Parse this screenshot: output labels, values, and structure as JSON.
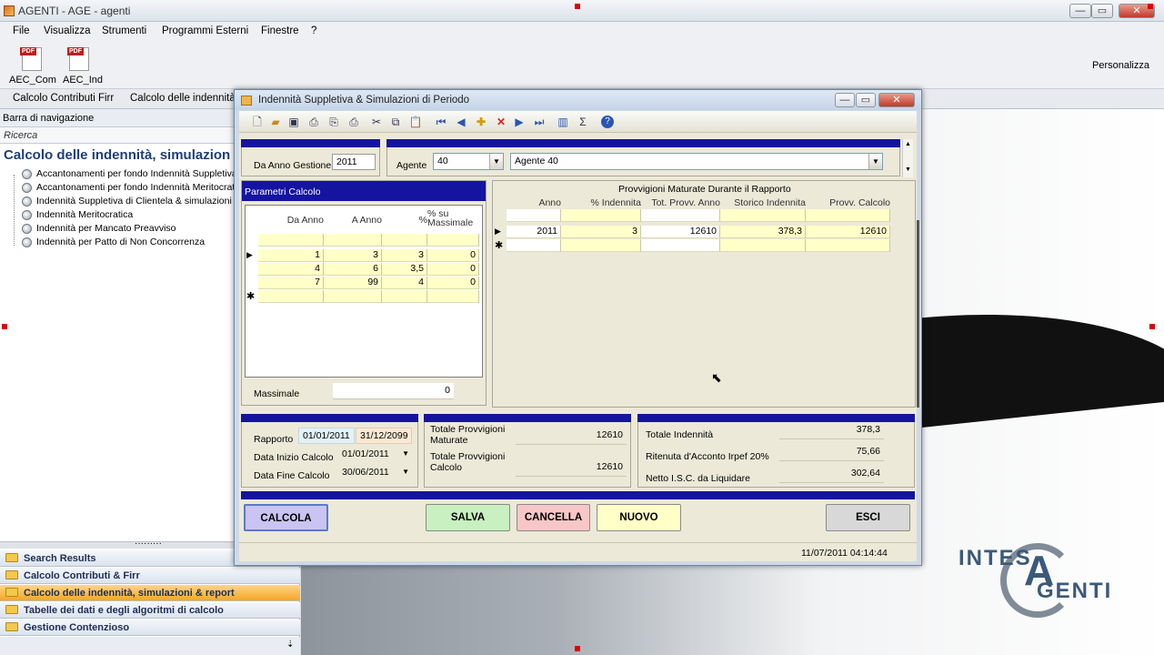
{
  "window": {
    "title": "AGENTI - AGE - agenti",
    "min": "—",
    "max": "▭",
    "close": "✕"
  },
  "menu": [
    "File",
    "Visualizza",
    "Strumenti",
    "Programmi Esterni",
    "Finestre",
    "?"
  ],
  "toolbar": {
    "btn1": "AEC_Com",
    "btn2": "AEC_Ind",
    "personalizza": "Personalizza"
  },
  "tabs": [
    "Calcolo Contributi  Firr",
    "Calcolo delle indennità"
  ],
  "nav": {
    "header": "Barra di navigazione",
    "search": "Ricerca",
    "title": "Calcolo delle indennità, simulazion",
    "items": [
      "Accantonamenti per fondo Indennità Suppletiva d",
      "Accantonamenti per fondo Indennità Meritocratic",
      "Indennità Suppletiva di Clientela & simulazioni di p",
      "Indennità Meritocratica",
      "Indennità per Mancato Preavviso",
      "Indennità per Patto di Non Concorrenza"
    ],
    "splitter": "·········",
    "groups": [
      "Search Results",
      "Calcolo Contributi & Firr",
      "Calcolo delle indennità, simulazioni & report",
      "Tabelle dei dati e degli algoritmi di calcolo",
      "Gestione Contenzioso"
    ],
    "more": "⇣"
  },
  "logo": {
    "line1": "INTES",
    "a": "A",
    "line2": "GENTI"
  },
  "dialog": {
    "title": "Indennità Suppletiva & Simulazioni di Periodo",
    "da_anno_label": "Da Anno Gestione",
    "da_anno_value": "2011",
    "agente_label": "Agente",
    "agente_code": "40",
    "agente_name": "Agente 40",
    "param_title": "Parametri Calcolo",
    "param_headers": [
      "Da Anno",
      "A Anno",
      "%",
      "% su Massimale"
    ],
    "param_rows": [
      [
        "1",
        "3",
        "3",
        "0"
      ],
      [
        "4",
        "6",
        "3,5",
        "0"
      ],
      [
        "7",
        "99",
        "4",
        "0"
      ]
    ],
    "massimale_label": "Massimale",
    "massimale_value": "0",
    "provv_title": "Provvigioni Maturate Durante il Rapporto",
    "provv_headers": [
      "Anno",
      "% Indennita",
      "Tot. Provv. Anno",
      "Storico Indennita",
      "Provv. Calcolo"
    ],
    "provv_rows": [
      [
        "2011",
        "3",
        "12610",
        "378,3",
        "12610"
      ]
    ],
    "rapporto_label": "Rapporto",
    "rapporto_from": "01/01/2011",
    "rapporto_to": "31/12/2099",
    "inizio_label": "Data Inizio Calcolo",
    "inizio_value": "01/01/2011",
    "fine_label": "Data Fine Calcolo",
    "fine_value": "30/06/2011",
    "tot_provv_mat_label": "Totale Provvigioni Maturate",
    "tot_provv_mat_value": "12610",
    "tot_provv_calc_label": "Totale Provvigioni Calcolo",
    "tot_provv_calc_value": "12610",
    "tot_ind_label": "Totale Indennità",
    "tot_ind_value": "378,3",
    "ritenuta_label": "Ritenuta d'Acconto Irpef 20%",
    "ritenuta_value": "75,66",
    "netto_label": "Netto I.S.C. da Liquidare",
    "netto_value": "302,64",
    "buttons": {
      "calcola": "CALCOLA",
      "salva": "SALVA",
      "cancella": "CANCELLA",
      "nuovo": "NUOVO",
      "esci": "ESCI"
    },
    "status_time": "11/07/2011 04:14:44",
    "colors": {
      "calcola": "#c9c4f2",
      "salva": "#c8f0c0",
      "cancella": "#f7c7c7",
      "nuovo": "#ffffc8",
      "esci": "#d8d8d8",
      "bluebar": "#1414a0"
    }
  }
}
